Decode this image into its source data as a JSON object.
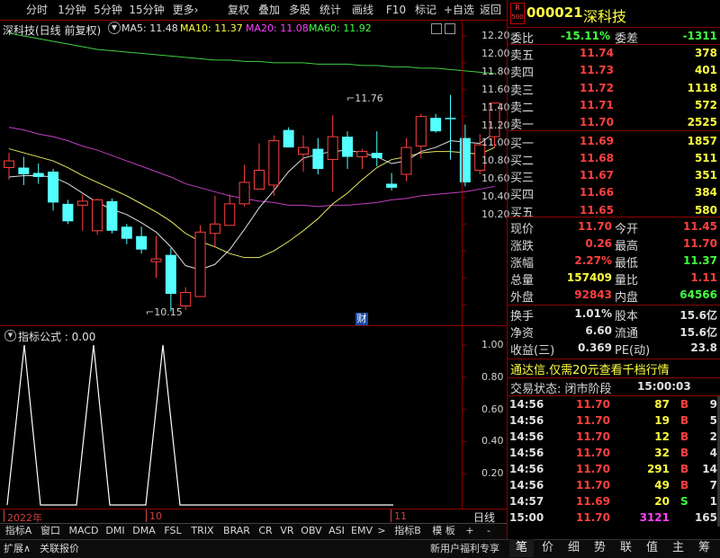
{
  "toolbar": {
    "tabs": [
      "分时",
      "1分钟",
      "5分钟",
      "15分钟",
      "更多"
    ],
    "buttons": [
      "复权",
      "叠加",
      "多股",
      "统计",
      "画线",
      "F10",
      "标记",
      "+自选",
      "返回"
    ]
  },
  "chart_header": {
    "title": "深科技(日线 前复权)",
    "ma5": "MA5: 11.48",
    "ma10": "MA10: 11.37",
    "ma20": "MA20: 11.08",
    "ma60": "MA60: 11.92"
  },
  "price_axis": [
    "12.20",
    "12.00",
    "11.80",
    "11.60",
    "11.40",
    "11.20",
    "11.00",
    "10.80",
    "10.60",
    "10.40",
    "10.20"
  ],
  "annotations": {
    "high": "11.76",
    "low": "10.15",
    "cai": "财"
  },
  "indicator": {
    "label": "指标公式 : 0.00",
    "axis": [
      "1.00",
      "0.80",
      "0.60",
      "0.40",
      "0.20"
    ]
  },
  "date_axis": {
    "left": "2022年",
    "mid": "10",
    "right": "11",
    "period": "日线"
  },
  "bottom_tabs": [
    "指标A",
    "窗口",
    "MACD",
    "DMI",
    "DMA",
    "FSL",
    "TRIX",
    "BRAR",
    "CR",
    "VR",
    "OBV",
    "ASI",
    "EMV",
    ">",
    "指标B",
    "模 板",
    "+",
    "-"
  ],
  "footer": {
    "expand": "扩展∧",
    "linked": "关联报价",
    "promo": "新用户福利专享"
  },
  "footer_buttons": [
    "笔",
    "价",
    "细",
    "势",
    "联",
    "值",
    "主",
    "筹"
  ],
  "stock": {
    "code": "000021",
    "name": "深科技",
    "badge_r": "R",
    "badge_num": "500"
  },
  "weibi": {
    "label": "委比",
    "value": "-15.11%",
    "label2": "委差",
    "value2": "-1311"
  },
  "asks": [
    {
      "label": "卖五",
      "price": "11.74",
      "vol": "378"
    },
    {
      "label": "卖四",
      "price": "11.73",
      "vol": "401"
    },
    {
      "label": "卖三",
      "price": "11.72",
      "vol": "1118"
    },
    {
      "label": "卖二",
      "price": "11.71",
      "vol": "572"
    },
    {
      "label": "卖一",
      "price": "11.70",
      "vol": "2525"
    }
  ],
  "bids": [
    {
      "label": "买一",
      "price": "11.69",
      "vol": "1857"
    },
    {
      "label": "买二",
      "price": "11.68",
      "vol": "511"
    },
    {
      "label": "买三",
      "price": "11.67",
      "vol": "351"
    },
    {
      "label": "买四",
      "price": "11.66",
      "vol": "384"
    },
    {
      "label": "买五",
      "price": "11.65",
      "vol": "580"
    }
  ],
  "stats1": [
    {
      "l1": "现价",
      "v1": "11.70",
      "c1": "#ff4040",
      "l2": "今开",
      "v2": "11.45",
      "c2": "#ff4040"
    },
    {
      "l1": "涨跌",
      "v1": "0.26",
      "c1": "#ff4040",
      "l2": "最高",
      "v2": "11.70",
      "c2": "#ff4040"
    },
    {
      "l1": "涨幅",
      "v1": "2.27%",
      "c1": "#ff4040",
      "l2": "最低",
      "v2": "11.37",
      "c2": "#40ff40"
    },
    {
      "l1": "总量",
      "v1": "157409",
      "c1": "#ffff40",
      "l2": "量比",
      "v2": "1.11",
      "c2": "#ff4040"
    },
    {
      "l1": "外盘",
      "v1": "92843",
      "c1": "#ff4040",
      "l2": "内盘",
      "v2": "64566",
      "c2": "#40ff40"
    }
  ],
  "stats2": [
    {
      "l1": "换手",
      "v1": "1.01%",
      "l2": "股本",
      "v2": "15.6亿"
    },
    {
      "l1": "净资",
      "v1": "6.60",
      "l2": "流通",
      "v2": "15.6亿"
    },
    {
      "l1": "收益(三)",
      "v1": "0.369",
      "l2": "PE(动)",
      "v2": "23.8"
    }
  ],
  "promo_line": "通达信.仅需20元查看千档行情",
  "trade_status": {
    "label": "交易状态: 闭市阶段",
    "time": "15:00:03"
  },
  "ticks": [
    {
      "t": "14:56",
      "p": "11.70",
      "v": "87",
      "d": "B",
      "n": "9",
      "pc": "#ff4040",
      "vc": "#ffff40",
      "dc": "#ff4040"
    },
    {
      "t": "14:56",
      "p": "11.70",
      "v": "19",
      "d": "B",
      "n": "5",
      "pc": "#ff4040",
      "vc": "#ffff40",
      "dc": "#ff4040"
    },
    {
      "t": "14:56",
      "p": "11.70",
      "v": "12",
      "d": "B",
      "n": "2",
      "pc": "#ff4040",
      "vc": "#ffff40",
      "dc": "#ff4040"
    },
    {
      "t": "14:56",
      "p": "11.70",
      "v": "32",
      "d": "B",
      "n": "4",
      "pc": "#ff4040",
      "vc": "#ffff40",
      "dc": "#ff4040"
    },
    {
      "t": "14:56",
      "p": "11.70",
      "v": "291",
      "d": "B",
      "n": "14",
      "pc": "#ff4040",
      "vc": "#ffff40",
      "dc": "#ff4040"
    },
    {
      "t": "14:56",
      "p": "11.70",
      "v": "49",
      "d": "B",
      "n": "7",
      "pc": "#ff4040",
      "vc": "#ffff40",
      "dc": "#ff4040"
    },
    {
      "t": "14:57",
      "p": "11.69",
      "v": "20",
      "d": "S",
      "n": "1",
      "pc": "#ff4040",
      "vc": "#ffff40",
      "dc": "#40ff40"
    },
    {
      "t": "15:00",
      "p": "11.70",
      "v": "3121",
      "d": "",
      "n": "165",
      "pc": "#ff4040",
      "vc": "#ff40ff",
      "dc": "#ff4040"
    }
  ],
  "chart_data": {
    "type": "candlestick",
    "ylim": [
      10.1,
      12.3
    ],
    "candles": [
      {
        "o": 11.22,
        "c": 11.27,
        "h": 11.33,
        "l": 11.13
      },
      {
        "o": 11.22,
        "c": 11.17,
        "h": 11.3,
        "l": 11.09
      },
      {
        "o": 11.18,
        "c": 11.15,
        "h": 11.25,
        "l": 11.1
      },
      {
        "o": 11.19,
        "c": 10.96,
        "h": 11.21,
        "l": 10.9
      },
      {
        "o": 10.95,
        "c": 10.82,
        "h": 10.98,
        "l": 10.8
      },
      {
        "o": 10.94,
        "c": 10.97,
        "h": 11.02,
        "l": 10.75
      },
      {
        "o": 10.75,
        "c": 10.98,
        "h": 10.99,
        "l": 10.72
      },
      {
        "o": 10.97,
        "c": 10.75,
        "h": 10.99,
        "l": 10.73
      },
      {
        "o": 10.78,
        "c": 10.69,
        "h": 10.8,
        "l": 10.65
      },
      {
        "o": 10.71,
        "c": 10.61,
        "h": 10.78,
        "l": 10.58
      },
      {
        "o": 10.52,
        "c": 10.54,
        "h": 10.71,
        "l": 10.4
      },
      {
        "o": 10.57,
        "c": 10.28,
        "h": 10.62,
        "l": 10.15
      },
      {
        "o": 10.19,
        "c": 10.29,
        "h": 10.33,
        "l": 10.16
      },
      {
        "o": 10.26,
        "c": 10.74,
        "h": 10.79,
        "l": 10.26
      },
      {
        "o": 10.73,
        "c": 10.8,
        "h": 11.01,
        "l": 10.63
      },
      {
        "o": 10.79,
        "c": 10.95,
        "h": 11.02,
        "l": 10.79
      },
      {
        "o": 10.95,
        "c": 11.11,
        "h": 11.24,
        "l": 10.93
      },
      {
        "o": 11.06,
        "c": 11.2,
        "h": 11.4,
        "l": 11.06
      },
      {
        "o": 11.09,
        "c": 11.42,
        "h": 11.46,
        "l": 11.01
      },
      {
        "o": 11.5,
        "c": 11.37,
        "h": 11.52,
        "l": 11.37
      },
      {
        "o": 11.32,
        "c": 11.37,
        "h": 11.46,
        "l": 11.19
      },
      {
        "o": 11.36,
        "c": 11.21,
        "h": 11.44,
        "l": 11.17
      },
      {
        "o": 11.28,
        "c": 11.45,
        "h": 11.61,
        "l": 11.04
      },
      {
        "o": 11.45,
        "c": 11.3,
        "h": 11.49,
        "l": 11.21
      },
      {
        "o": 11.3,
        "c": 11.34,
        "h": 11.36,
        "l": 11.21
      },
      {
        "o": 11.33,
        "c": 11.29,
        "h": 11.49,
        "l": 11.23
      },
      {
        "o": 11.1,
        "c": 11.07,
        "h": 11.18,
        "l": 11.05
      },
      {
        "o": 11.17,
        "c": 11.37,
        "h": 11.44,
        "l": 11.12
      },
      {
        "o": 11.38,
        "c": 11.6,
        "h": 11.62,
        "l": 11.29
      },
      {
        "o": 11.59,
        "c": 11.49,
        "h": 11.62,
        "l": 11.48
      },
      {
        "o": 11.59,
        "c": 11.58,
        "h": 11.76,
        "l": 11.28
      },
      {
        "o": 11.44,
        "c": 11.11,
        "h": 11.54,
        "l": 11.08
      },
      {
        "o": 11.2,
        "c": 11.39,
        "h": 11.47,
        "l": 11.17
      },
      {
        "o": 11.45,
        "c": 11.7,
        "h": 11.7,
        "l": 11.37
      }
    ],
    "ma5": [
      11.15,
      11.16,
      11.16,
      11.15,
      11.1,
      11.03,
      10.96,
      10.91,
      10.87,
      10.81,
      10.74,
      10.63,
      10.49,
      10.46,
      10.5,
      10.61,
      10.76,
      10.92,
      11.05,
      11.19,
      11.29,
      11.32,
      11.34,
      11.35,
      11.33,
      11.3,
      11.25,
      11.27,
      11.34,
      11.37,
      11.42,
      11.41,
      11.4,
      11.48
    ],
    "ma10": [
      11.36,
      11.33,
      11.3,
      11.27,
      11.22,
      11.16,
      11.11,
      11.06,
      11.01,
      10.95,
      10.89,
      10.82,
      10.73,
      10.67,
      10.63,
      10.58,
      10.55,
      10.55,
      10.6,
      10.67,
      10.75,
      10.84,
      10.95,
      11.03,
      11.13,
      11.22,
      11.28,
      11.3,
      11.33,
      11.34,
      11.34,
      11.33,
      11.32,
      11.37
    ],
    "ma20": [
      11.52,
      11.5,
      11.47,
      11.45,
      11.42,
      11.38,
      11.35,
      11.31,
      11.27,
      11.23,
      11.19,
      11.15,
      11.1,
      11.07,
      11.04,
      11.01,
      10.99,
      10.97,
      10.96,
      10.94,
      10.94,
      10.93,
      10.94,
      10.94,
      10.95,
      10.96,
      10.98,
      10.99,
      11.01,
      11.02,
      11.03,
      11.04,
      11.06,
      11.08
    ],
    "ma60": [
      12.22,
      12.2,
      12.18,
      12.16,
      12.14,
      12.12,
      12.1,
      12.09,
      12.08,
      12.07,
      12.06,
      12.05,
      12.04,
      12.03,
      12.02,
      12.02,
      12.01,
      12.01,
      12.0,
      12.0,
      12.0,
      11.99,
      11.99,
      11.99,
      11.98,
      11.98,
      11.97,
      11.97,
      11.96,
      11.96,
      11.95,
      11.94,
      11.93,
      11.92
    ],
    "indicator_ylim": [
      0,
      1.1
    ],
    "indicator_series": [
      0,
      0,
      1,
      0,
      0,
      0,
      0,
      1,
      0,
      0,
      0,
      0,
      0,
      0,
      0,
      0,
      0,
      0,
      0,
      0,
      0,
      0,
      0,
      0,
      0,
      0,
      0,
      0,
      0,
      0,
      0,
      0,
      0,
      0,
      0,
      0,
      0,
      0,
      0,
      0,
      0,
      0,
      0,
      0,
      0,
      0,
      0,
      0,
      0,
      0,
      0,
      0,
      0,
      0,
      0,
      0,
      0,
      0,
      0,
      0
    ]
  }
}
